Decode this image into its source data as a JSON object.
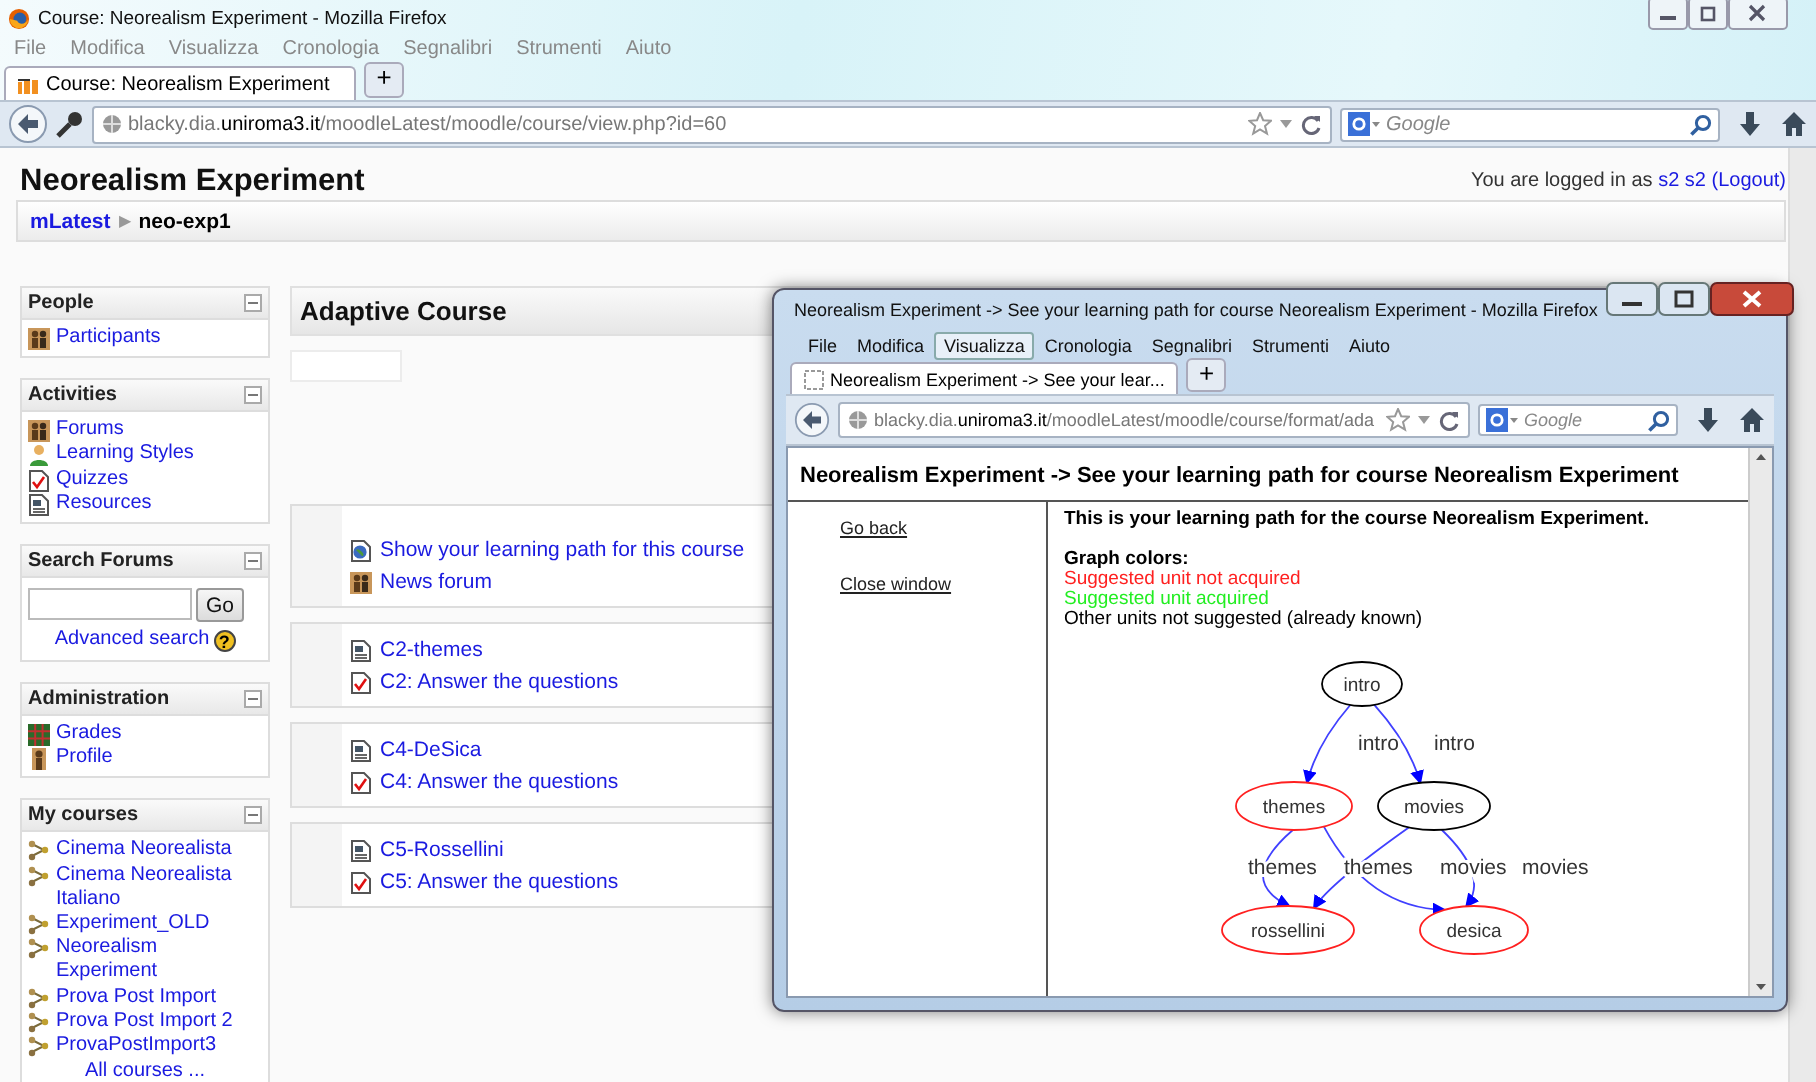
{
  "browser": {
    "title": "Course: Neorealism Experiment - Mozilla Firefox",
    "menu": [
      {
        "label": "File",
        "selected": false
      },
      {
        "label": "Modifica",
        "selected": false
      },
      {
        "label": "Visualizza",
        "selected": false
      },
      {
        "label": "Cronologia",
        "selected": false
      },
      {
        "label": "Segnalibri",
        "selected": false
      },
      {
        "label": "Strumenti",
        "selected": false
      },
      {
        "label": "Aiuto",
        "selected": false
      }
    ],
    "tabs": [
      {
        "label": "Course: Neorealism Experiment",
        "selected": true
      }
    ],
    "new_tab": "+",
    "url": "blacky.dia.**uniroma3.it**/moodleLatest/moodle/course/view.php?id=60",
    "search": {
      "placeholder": "Google"
    }
  },
  "page": {
    "heading": "Neorealism Experiment",
    "login": {
      "text": "You are logged in as",
      "user": "s2 s2",
      "logout": "(Logout)"
    },
    "breadcrumb": {
      "items": [
        "mLatest",
        "neo-exp1"
      ],
      "separator": "▶"
    },
    "blocks": [
      {
        "kind": "links",
        "title": "People",
        "items": [
          {
            "label": "Participants",
            "kind": "users"
          }
        ]
      },
      {
        "kind": "links",
        "title": "Activities",
        "items": [
          {
            "label": "Forums",
            "kind": "forum"
          },
          {
            "label": "Learning Styles",
            "kind": "style"
          },
          {
            "label": "Quizzes",
            "kind": "quiz"
          },
          {
            "label": "Resources",
            "kind": "resource"
          }
        ]
      },
      {
        "kind": "search",
        "title": "Search Forums",
        "button": "Go",
        "link": "Advanced search",
        "help": "?"
      },
      {
        "kind": "links",
        "title": "Administration",
        "items": [
          {
            "label": "Grades",
            "kind": "grades"
          },
          {
            "label": "Profile",
            "kind": "profile"
          }
        ]
      },
      {
        "kind": "links",
        "title": "My courses",
        "items": [
          {
            "label": "Cinema Neorealista",
            "kind": "course"
          },
          {
            "label": "Cinema Neorealista Italiano",
            "kind": "course"
          },
          {
            "label": "Experiment_OLD",
            "kind": "course"
          },
          {
            "label": "Neorealism Experiment",
            "kind": "course"
          },
          {
            "label": "Prova Post Import",
            "kind": "course"
          },
          {
            "label": "Prova Post Import 2",
            "kind": "course"
          },
          {
            "label": "ProvaPostImport3",
            "kind": "course"
          }
        ],
        "footer": "All courses ..."
      }
    ],
    "course": {
      "title": "Adaptive Course",
      "sections": [
        {
          "items": [
            {
              "label": "Show your learning path for this course",
              "kind": "path"
            },
            {
              "label": "News forum",
              "kind": "forum"
            }
          ]
        },
        {
          "items": [
            {
              "label": "C2-themes",
              "kind": "resource"
            },
            {
              "label": "C2: Answer the questions",
              "kind": "quiz"
            }
          ]
        },
        {
          "items": [
            {
              "label": "C4-DeSica",
              "kind": "resource"
            },
            {
              "label": "C4: Answer the questions",
              "kind": "quiz"
            }
          ]
        },
        {
          "items": [
            {
              "label": "C5-Rossellini",
              "kind": "resource"
            },
            {
              "label": "C5: Answer the questions",
              "kind": "quiz"
            }
          ]
        }
      ]
    }
  },
  "popup": {
    "title": "Neorealism Experiment -> See your learning path for course Neorealism Experiment - Mozilla Firefox",
    "menu": [
      {
        "label": "File",
        "selected": false
      },
      {
        "label": "Modifica",
        "selected": false
      },
      {
        "label": "Visualizza",
        "selected": true
      },
      {
        "label": "Cronologia",
        "selected": false
      },
      {
        "label": "Segnalibri",
        "selected": false
      },
      {
        "label": "Strumenti",
        "selected": false
      },
      {
        "label": "Aiuto",
        "selected": false
      }
    ],
    "tabs": [
      {
        "label": "Neorealism Experiment -> See your lear...",
        "selected": true
      }
    ],
    "new_tab": "+",
    "url": "blacky.dia.**uniroma3.it**/moodleLatest/moodle/course/format/ada",
    "search": {
      "placeholder": "Google"
    },
    "heading": "Neorealism Experiment -> See your learning path for course Neorealism Experiment",
    "links": [
      "Go back",
      "Close window"
    ],
    "intro": "This is your learning path for the course Neorealism Experiment.",
    "legend": {
      "title": "Graph colors:",
      "items": [
        {
          "label": "Suggested unit not acquired",
          "color": "#ff2020"
        },
        {
          "label": "Suggested unit acquired",
          "color": "#22ee22"
        },
        {
          "label": "Other units not suggested (already known)",
          "color": "#000000"
        }
      ]
    },
    "graph": {
      "nodes": [
        {
          "label": "intro",
          "color": "#000000"
        },
        {
          "label": "themes",
          "color": "#ff2020"
        },
        {
          "label": "movies",
          "color": "#000000"
        },
        {
          "label": "rossellini",
          "color": "#ff2020"
        },
        {
          "label": "desica",
          "color": "#ff2020"
        }
      ],
      "edges": [
        {
          "label": "intro"
        },
        {
          "label": "intro"
        },
        {
          "label": "themes"
        },
        {
          "label": "themes"
        },
        {
          "label": "movies"
        },
        {
          "label": "movies"
        }
      ]
    }
  }
}
